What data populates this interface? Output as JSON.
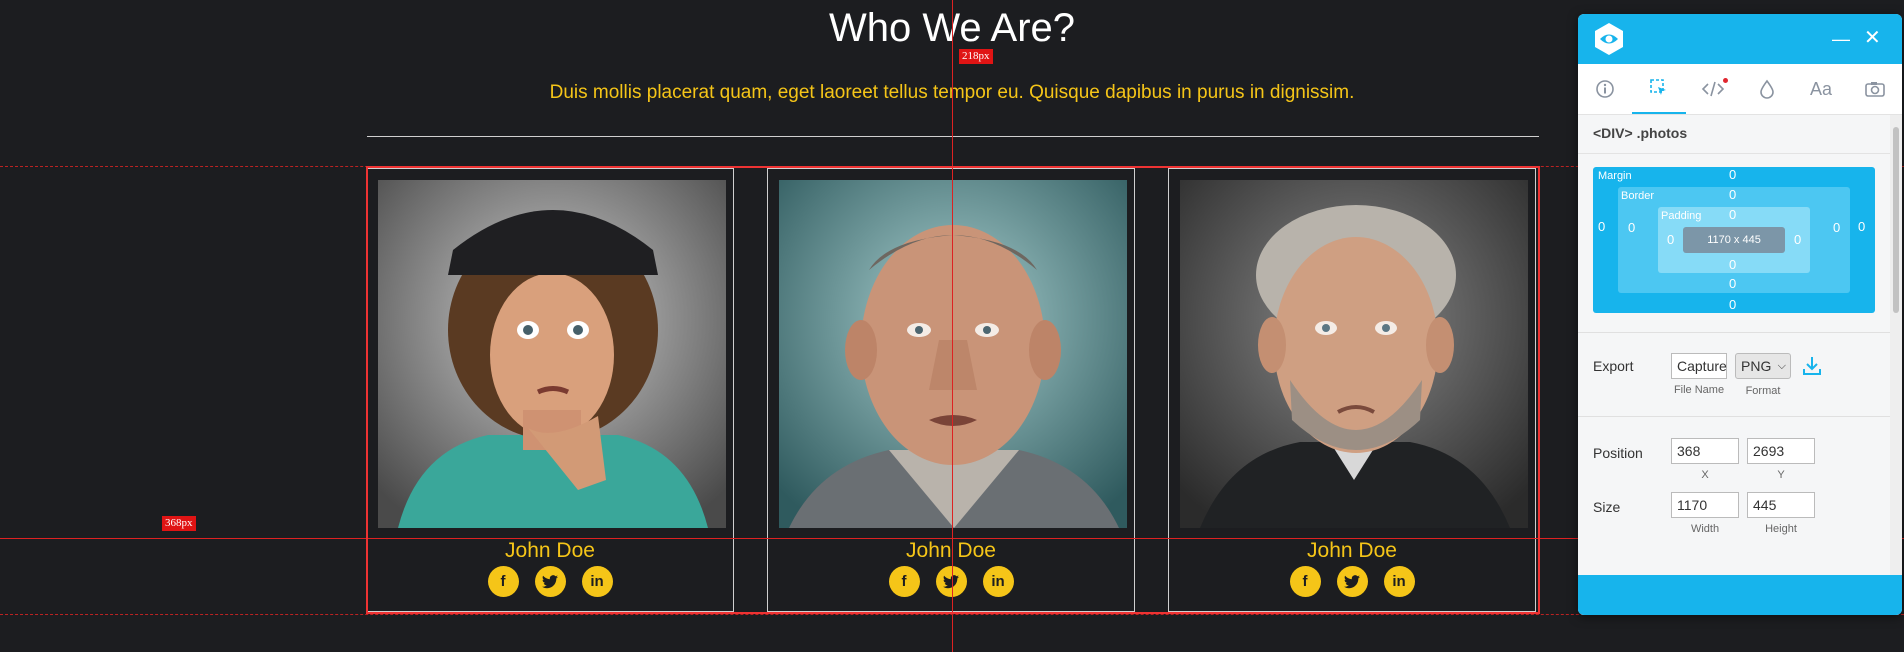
{
  "section": {
    "title": "Who We Are?",
    "subtitle": "Duis mollis placerat quam, eget laoreet tellus tempor eu. Quisque dapibus in purus in dignissim."
  },
  "guides": {
    "top_tag": "218px",
    "left_tag": "368px"
  },
  "team": [
    {
      "name": "John Doe",
      "socials": [
        "facebook-icon",
        "twitter-icon",
        "linkedin-icon"
      ]
    },
    {
      "name": "John Doe",
      "socials": [
        "facebook-icon",
        "twitter-icon",
        "linkedin-icon"
      ]
    },
    {
      "name": "John Doe",
      "socials": [
        "facebook-icon",
        "twitter-icon",
        "linkedin-icon"
      ]
    }
  ],
  "inspector": {
    "tabs": [
      "info-icon",
      "select-icon",
      "code-icon",
      "color-drop-icon",
      "typography-icon",
      "camera-icon"
    ],
    "selector": "<DIV> .photos",
    "box_model": {
      "margin_label": "Margin",
      "border_label": "Border",
      "padding_label": "Padding",
      "margin": [
        "0",
        "0",
        "0",
        "0"
      ],
      "border": [
        "0",
        "0",
        "0",
        "0"
      ],
      "padding": [
        "0",
        "0",
        "0",
        "0"
      ],
      "content": "1170 x 445"
    },
    "export": {
      "label": "Export",
      "file_name": "Capture",
      "file_name_caption": "File Name",
      "format": "PNG",
      "format_caption": "Format"
    },
    "position": {
      "label": "Position",
      "x": "368",
      "y": "2693",
      "x_caption": "X",
      "y_caption": "Y"
    },
    "size": {
      "label": "Size",
      "width": "1170",
      "height": "445",
      "width_caption": "Width",
      "height_caption": "Height"
    }
  },
  "colors": {
    "accent": "#f5c518",
    "panel": "#17b4ec",
    "guide": "#dd2222"
  }
}
